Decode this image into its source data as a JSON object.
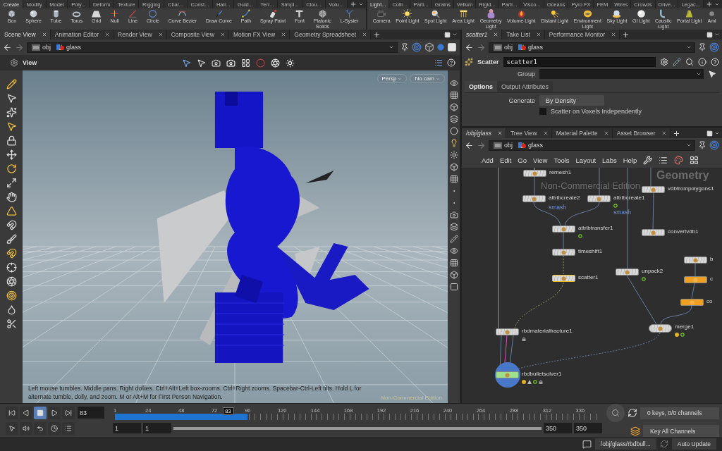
{
  "shelf_left": {
    "tabs": [
      {
        "label": "Create",
        "selected": true
      },
      {
        "label": "Modify",
        "selected": false
      },
      {
        "label": "Model",
        "selected": false
      },
      {
        "label": "Poly...",
        "selected": false
      },
      {
        "label": "Deform",
        "selected": false
      },
      {
        "label": "Texture",
        "selected": false
      },
      {
        "label": "Rigging",
        "selected": false
      },
      {
        "label": "Char...",
        "selected": false
      },
      {
        "label": "Const...",
        "selected": false
      },
      {
        "label": "Hair...",
        "selected": false
      },
      {
        "label": "Guid...",
        "selected": false
      },
      {
        "label": "Terr...",
        "selected": false
      },
      {
        "label": "Simpl...",
        "selected": false
      },
      {
        "label": "Clou...",
        "selected": false
      },
      {
        "label": "Volu...",
        "selected": false
      }
    ],
    "tools": [
      "Box",
      "Sphere",
      "Tube",
      "Torus",
      "Grid",
      "Null",
      "Line",
      "Circle",
      "Curve Bezier",
      "Draw Curve",
      "Path",
      "Spray Paint",
      "Font",
      "Platonic\nSolids",
      "L-Syster"
    ]
  },
  "shelf_right": {
    "tabs": [
      {
        "label": "Light...",
        "selected": true
      },
      {
        "label": "Colli...",
        "selected": false
      },
      {
        "label": "Parti...",
        "selected": false
      },
      {
        "label": "Grains",
        "selected": false
      },
      {
        "label": "Vellum",
        "selected": false
      },
      {
        "label": "Rigid...",
        "selected": false
      },
      {
        "label": "Parti...",
        "selected": false
      },
      {
        "label": "Visco...",
        "selected": false
      },
      {
        "label": "Oceans",
        "selected": false
      },
      {
        "label": "Pyro FX",
        "selected": false
      },
      {
        "label": "FEM",
        "selected": false
      },
      {
        "label": "Wires",
        "selected": false
      },
      {
        "label": "Crowds",
        "selected": false
      },
      {
        "label": "Drive...",
        "selected": false
      },
      {
        "label": "Legac...",
        "selected": false
      }
    ],
    "tools": [
      "Camera",
      "Point Light",
      "Spot Light",
      "Area Light",
      "Geometry\nLight",
      "Volume Light",
      "Distant Light",
      "Environment\nLight",
      "Sky Light",
      "GI Light",
      "Caustic\nLight",
      "Portal Light",
      "Aml"
    ]
  },
  "scene_pane": {
    "tabs": [
      {
        "label": "Scene View",
        "selected": true
      },
      {
        "label": "Animation Editor",
        "selected": false
      },
      {
        "label": "Render View",
        "selected": false
      },
      {
        "label": "Composite View",
        "selected": false
      },
      {
        "label": "Motion FX View",
        "selected": false
      },
      {
        "label": "Geometry Spreadsheet",
        "selected": false
      }
    ],
    "path": [
      "obj",
      "glass"
    ],
    "view_label": "View",
    "camera_buttons": [
      "Persp",
      "No cam"
    ],
    "help_text": "Left mouse tumbles. Middle pans. Right dollies. Ctrl+Alt+Left box-zooms. Ctrl+Right zooms. Spacebar-Ctrl-Left tilts. Hold L for alternate tumble, dolly, and zoom.    M or Alt+M for First Person Navigation.",
    "edition": "Non-Commercial Edition"
  },
  "param_pane": {
    "tabs": [
      {
        "label": "scatter1",
        "selected": true
      },
      {
        "label": "Take List",
        "selected": false
      },
      {
        "label": "Performance Monitor",
        "selected": false
      }
    ],
    "path": [
      "obj",
      "glass"
    ],
    "node_type": "Scatter",
    "node_name": "scatter1",
    "group_label": "Group",
    "subtabs": [
      {
        "label": "Options",
        "selected": true
      },
      {
        "label": "Output Attributes",
        "selected": false
      }
    ],
    "generate_label": "Generate",
    "generate_value": "By Density",
    "voxels": {
      "label": "Scatter on Voxels Independently",
      "checked": false
    }
  },
  "network_pane": {
    "tabs": [
      {
        "label": "/obj/glass",
        "selected": true
      },
      {
        "label": "Tree View",
        "selected": false
      },
      {
        "label": "Material Palette",
        "selected": false
      },
      {
        "label": "Asset Browser",
        "selected": false
      }
    ],
    "path": [
      "obj",
      "glass"
    ],
    "menu": [
      "Add",
      "Edit",
      "Go",
      "View",
      "Tools",
      "Layout",
      "Labs",
      "Help"
    ],
    "edition": "Non-Commercial Edition",
    "context": "Geometry",
    "nodes": [
      {
        "name": "remesh1",
        "kind": "sop"
      },
      {
        "name": "attribcreate2",
        "kind": "sop",
        "comment": "smash"
      },
      {
        "name": "attribcreate1",
        "kind": "sop",
        "comment": "smash",
        "ok": true
      },
      {
        "name": "attribtransfer1",
        "kind": "sop",
        "ok": true
      },
      {
        "name": "timeshift1",
        "kind": "sop"
      },
      {
        "name": "scatter1",
        "kind": "current"
      },
      {
        "name": "vdbfrompolygons1",
        "kind": "sop"
      },
      {
        "name": "convertvdb1",
        "kind": "sop"
      },
      {
        "name": "unpack2",
        "kind": "sop",
        "ok": true
      },
      {
        "name": "b",
        "kind": "sop"
      },
      {
        "name": "c",
        "kind": "flagged"
      },
      {
        "name": "co",
        "kind": "flagged"
      },
      {
        "name": "merge1",
        "kind": "merge",
        "warning": true,
        "ok": true
      },
      {
        "name": "rbdmaterialfracture1",
        "kind": "sop",
        "locked": true
      },
      {
        "name": "rbdbulletsolver1",
        "kind": "solver",
        "warning": true,
        "geometry": true,
        "ok": true,
        "locked": true
      }
    ]
  },
  "timeline": {
    "frame": "83",
    "marker": "83",
    "level": 0.235,
    "ticks": [
      "1",
      "24",
      "48",
      "72",
      "96",
      "120",
      "144",
      "168",
      "192",
      "216",
      "240",
      "264",
      "288",
      "312",
      "336"
    ],
    "range": [
      "1",
      "1",
      "350",
      "350"
    ],
    "keys": "0 keys, 0/0 channels",
    "key_mode": "Key All Channels"
  },
  "status_bar": {
    "path": "/obj/glass/rbdbull...",
    "update": "Auto Update"
  }
}
